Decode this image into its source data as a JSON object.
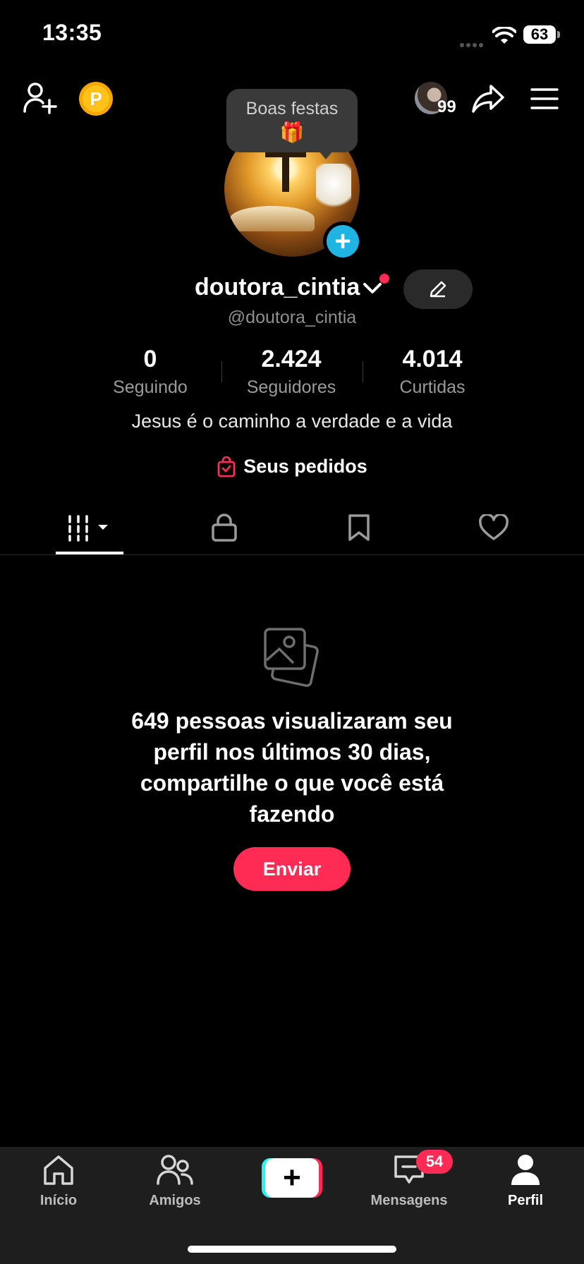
{
  "status_bar": {
    "time": "13:35",
    "battery": "63"
  },
  "top_bar": {
    "coin_letter": "P",
    "visitor_count": "99"
  },
  "tooltip": {
    "text": "Boas festas",
    "emoji": "🎁"
  },
  "profile": {
    "username": "doutora_cintia",
    "handle": "@doutora_cintia",
    "bio": "Jesus é o caminho a verdade e a vida",
    "orders_label": "Seus pedidos",
    "stats": [
      {
        "value": "0",
        "label": "Seguindo"
      },
      {
        "value": "2.424",
        "label": "Seguidores"
      },
      {
        "value": "4.014",
        "label": "Curtidas"
      }
    ]
  },
  "tabs": [
    "videos-grid",
    "private",
    "saved",
    "liked"
  ],
  "empty_state": {
    "message": "649 pessoas visualizaram seu perfil nos últimos 30 dias, compartilhe o que você está fazendo",
    "button_label": "Enviar"
  },
  "bottom_nav": {
    "items": [
      {
        "label": "Início"
      },
      {
        "label": "Amigos"
      },
      {
        "label": "Mensagens",
        "badge": "54"
      },
      {
        "label": "Perfil"
      }
    ],
    "create_symbol": "+"
  },
  "colors": {
    "accent": "#fe2c55",
    "plus_badge": "#20b4e3",
    "coin": "#f7a800",
    "cyan": "#25f4ee"
  }
}
